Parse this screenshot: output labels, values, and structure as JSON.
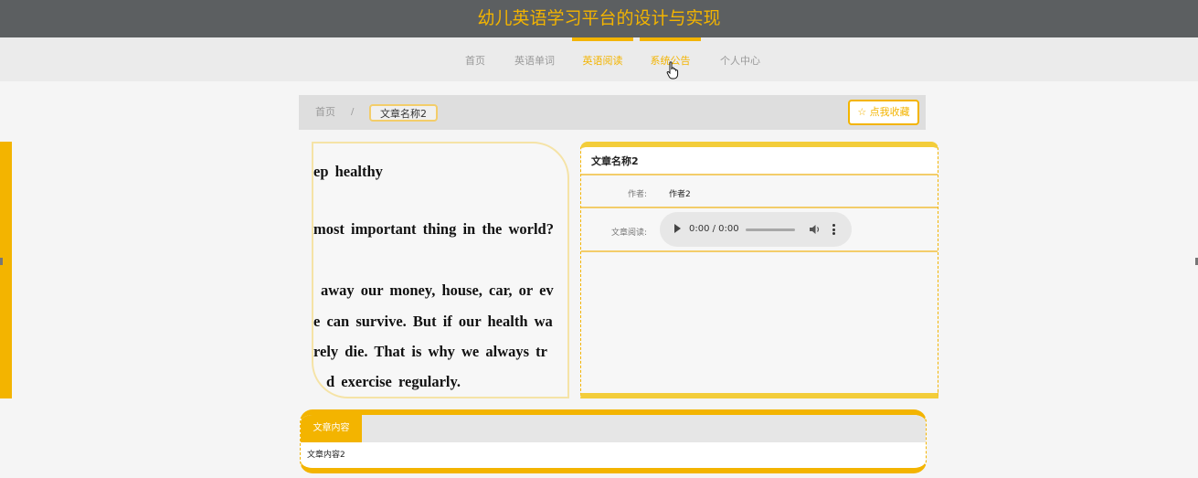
{
  "header": {
    "site_title": "幼儿英语学习平台的设计与实现"
  },
  "nav": {
    "items": [
      {
        "label": "首页",
        "active": false
      },
      {
        "label": "英语单词",
        "active": false
      },
      {
        "label": "英语阅读",
        "active": true
      },
      {
        "label": "系统公告",
        "active": true
      },
      {
        "label": "个人中心",
        "active": false
      }
    ]
  },
  "breadcrumb": {
    "home": "首页",
    "separator": "/",
    "current": "文章名称2"
  },
  "actions": {
    "favorite_label": "☆ 点我收藏"
  },
  "article_image": {
    "lines": [
      "ep healthy",
      "most important thing in the world?",
      "away our money, house, car, or ev",
      "e can survive. But if our health wa",
      "rely die. That is why we always tr",
      "d exercise regularly."
    ]
  },
  "article": {
    "title": "文章名称2",
    "author_label": "作者:",
    "author": "作者2",
    "audio_label": "文章阅读:",
    "audio_time": "0:00 / 0:00"
  },
  "content": {
    "tab_label": "文章内容",
    "body": "文章内容2"
  },
  "colors": {
    "accent": "#f3b400",
    "header_bg": "#5c5f61",
    "nav_bg": "#ebebeb"
  }
}
